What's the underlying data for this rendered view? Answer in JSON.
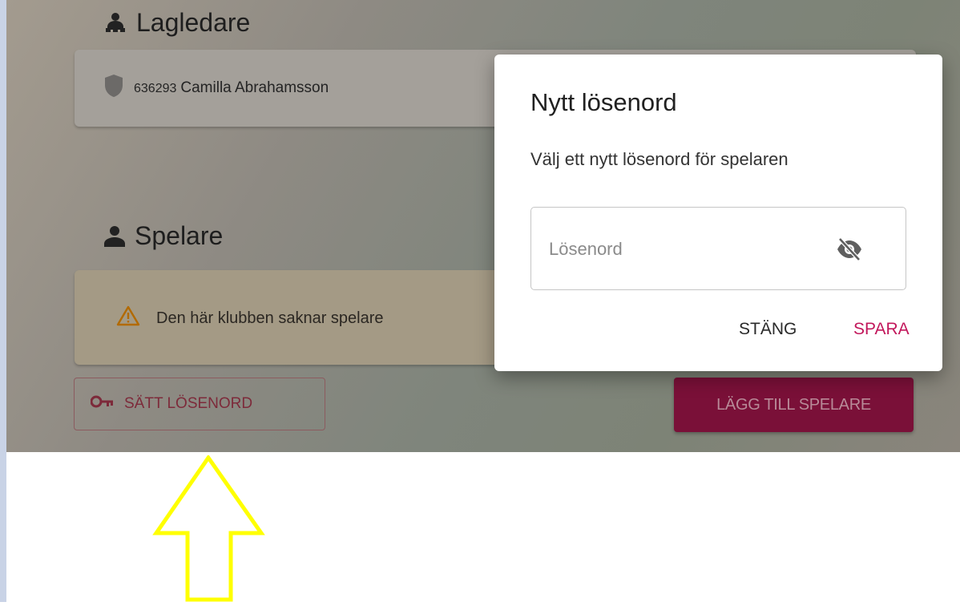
{
  "leaders": {
    "title": "Lagledare",
    "items": [
      {
        "id": "636293",
        "name": "Camilla Abrahamsson"
      }
    ]
  },
  "players": {
    "title": "Spelare",
    "empty_message": "Den här klubben saknar spelare"
  },
  "actions": {
    "set_password_label": "SÄTT LÖSENORD",
    "add_player_label": "LÄGG TILL SPELARE"
  },
  "dialog": {
    "title": "Nytt lösenord",
    "description": "Välj ett nytt lösenord för spelaren",
    "password_placeholder": "Lösenord",
    "password_value": "",
    "close_label": "STÄNG",
    "save_label": "SPARA"
  },
  "colors": {
    "accent": "#c2175b",
    "primary_button": "#7a1038",
    "annotation_arrow": "#ffff00",
    "warning_icon": "#b26a00"
  },
  "icons": {
    "leaders": "group-leader-icon",
    "players": "person-icon",
    "leader_badge": "shield-icon",
    "warning": "warning-icon",
    "key": "key-icon",
    "visibility": "visibility-off-icon",
    "annotation": "arrow-up-icon"
  }
}
